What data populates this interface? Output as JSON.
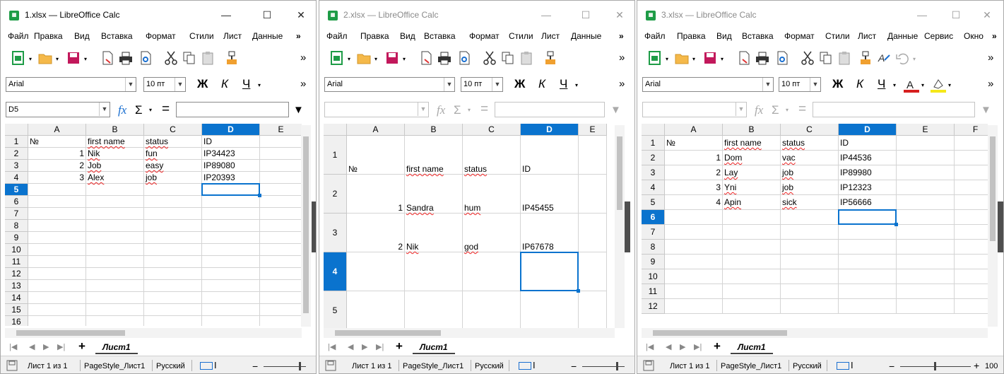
{
  "windows": [
    {
      "title": "1.xlsx — LibreOffice Calc",
      "menus": [
        "Файл",
        "Правка",
        "Вид",
        "Вставка",
        "Формат",
        "Стили",
        "Лист",
        "Данные",
        "»"
      ],
      "font": "Arial",
      "size": "10 пт",
      "namebox": "D5",
      "columns": [
        "A",
        "B",
        "C",
        "D",
        "E"
      ],
      "rows": [
        "1",
        "2",
        "3",
        "4",
        "5",
        "6",
        "7",
        "8",
        "9",
        "10",
        "11",
        "12",
        "13",
        "14",
        "15",
        "16"
      ],
      "cells": [
        [
          "№",
          "first name",
          "status",
          "ID"
        ],
        [
          "1",
          "Nik",
          "fun",
          "IP34423"
        ],
        [
          "2",
          "Job",
          "easy",
          "IP89080"
        ],
        [
          "3",
          "Alex",
          "job",
          "IP20393"
        ]
      ],
      "sheet_tab": "Лист1",
      "status": {
        "sheet": "Лист 1 из 1",
        "style": "PageStyle_Лист1",
        "lang": "Русский",
        "zoom": ""
      }
    },
    {
      "title": "2.xlsx — LibreOffice Calc",
      "menus": [
        "Файл",
        "Правка",
        "Вид",
        "Вставка",
        "Формат",
        "Стили",
        "Лист",
        "Данные",
        "»"
      ],
      "font": "Arial",
      "size": "10 пт",
      "namebox": "",
      "columns": [
        "A",
        "B",
        "C",
        "D",
        "E"
      ],
      "rows": [
        "1",
        "2",
        "3",
        "4",
        "5"
      ],
      "cells": [
        [
          "№",
          "first name",
          "status",
          "ID"
        ],
        [
          "1",
          "Sandra",
          "hum",
          "IP45455"
        ],
        [
          "2",
          "Nik",
          "god",
          "IP67678"
        ]
      ],
      "sheet_tab": "Лист1",
      "status": {
        "sheet": "Лист 1 из 1",
        "style": "PageStyle_Лист1",
        "lang": "Русский",
        "zoom": ""
      }
    },
    {
      "title": "3.xlsx — LibreOffice Calc",
      "menus": [
        "Файл",
        "Правка",
        "Вид",
        "Вставка",
        "Формат",
        "Стили",
        "Лист",
        "Данные",
        "Сервис",
        "Окно",
        "»"
      ],
      "font": "Arial",
      "size": "10 пт",
      "namebox": "",
      "columns": [
        "A",
        "B",
        "C",
        "D",
        "E",
        "F"
      ],
      "rows": [
        "1",
        "2",
        "3",
        "4",
        "5",
        "6",
        "7",
        "8",
        "9",
        "10",
        "11",
        "12"
      ],
      "cells": [
        [
          "№",
          "first name",
          "status",
          "ID"
        ],
        [
          "1",
          "Dom",
          "vac",
          "IP44536"
        ],
        [
          "2",
          "Lay",
          "job",
          "IP89980"
        ],
        [
          "3",
          "Yni",
          "job",
          "IP12323"
        ],
        [
          "4",
          "Apin",
          "sick",
          "IP56666"
        ]
      ],
      "sheet_tab": "Лист1",
      "status": {
        "sheet": "Лист 1 из 1",
        "style": "PageStyle_Лист1",
        "lang": "Русский",
        "zoom": "100"
      }
    }
  ],
  "icons": {
    "bold": "Ж",
    "italic": "К",
    "underline": "Ч",
    "fx": "fx",
    "sum": "Σ",
    "equals": "="
  },
  "colors": {
    "accent": "#0a73ce",
    "app": "#1e9c47"
  }
}
